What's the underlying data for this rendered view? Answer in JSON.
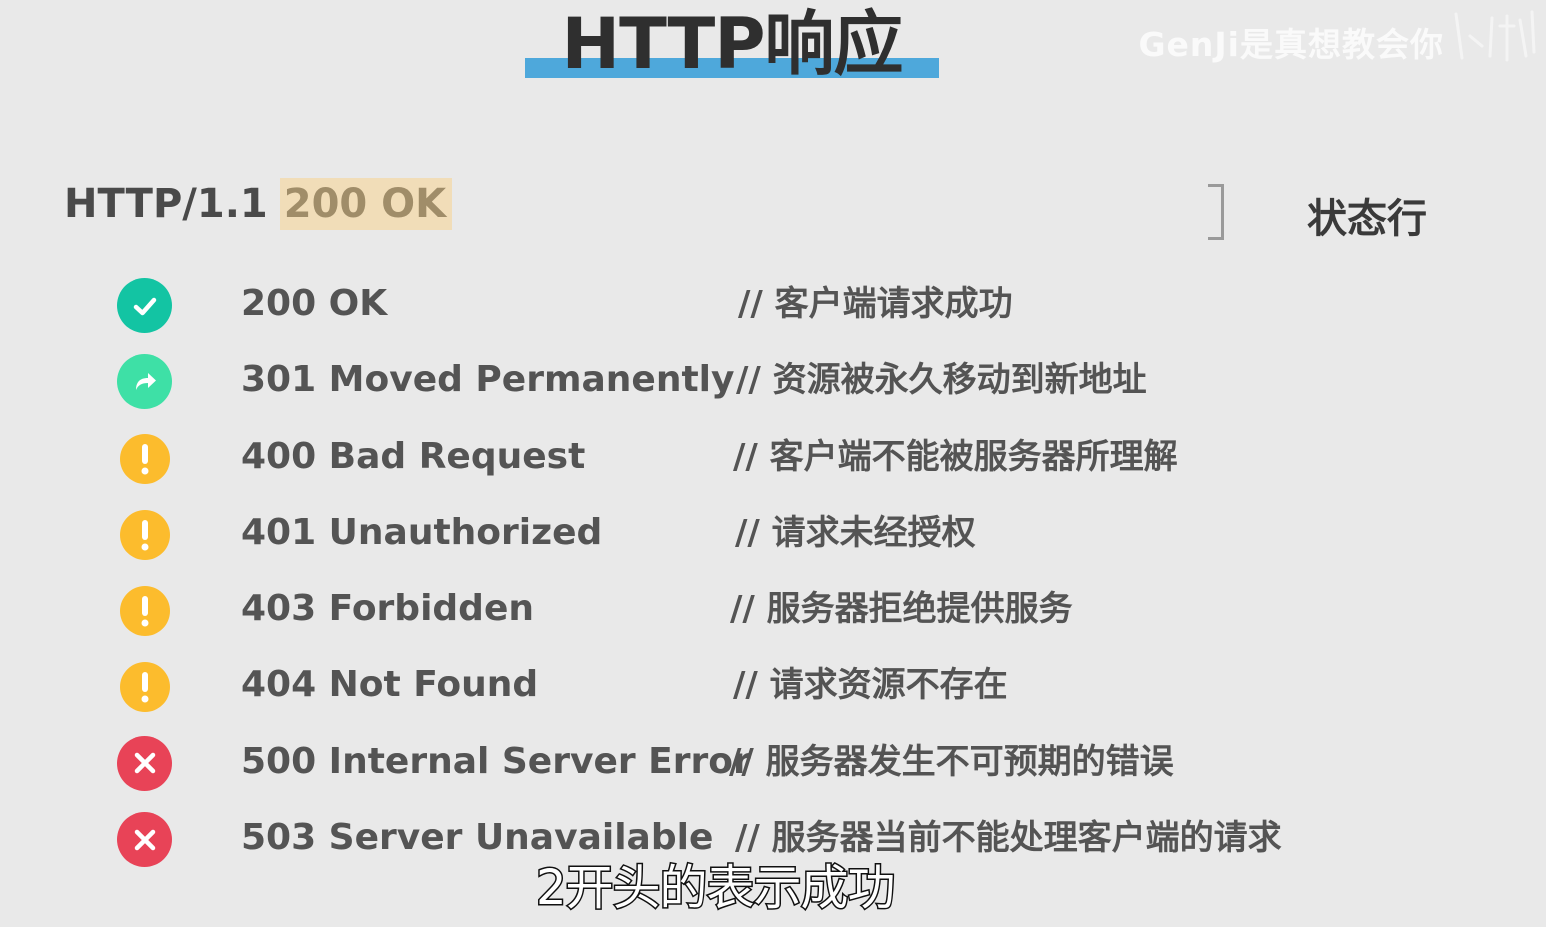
{
  "title": "HTTP响应",
  "watermark": "GenJi是真想教会你",
  "status_line": {
    "version": "HTTP/1.1",
    "status": "200 OK",
    "label": "状态行"
  },
  "codes": [
    {
      "code": "200 OK",
      "desc": "// 客户端请求成功",
      "icon": "check-icon",
      "kind": "success"
    },
    {
      "code": "301 Moved Permanently",
      "desc": "// 资源被永久移动到新地址",
      "icon": "redirect-arrow-icon",
      "kind": "redirect"
    },
    {
      "code": "400 Bad Request",
      "desc": "// 客户端不能被服务器所理解",
      "icon": "exclamation-icon",
      "kind": "warn"
    },
    {
      "code": "401 Unauthorized",
      "desc": "// 请求未经授权",
      "icon": "exclamation-icon",
      "kind": "warn"
    },
    {
      "code": "403 Forbidden",
      "desc": "// 服务器拒绝提供服务",
      "icon": "exclamation-icon",
      "kind": "warn"
    },
    {
      "code": "404 Not Found",
      "desc": "// 请求资源不存在",
      "icon": "exclamation-icon",
      "kind": "warn"
    },
    {
      "code": "500 Internal Server Error",
      "desc": "// 服务器发生不可预期的错误",
      "icon": "close-x-icon",
      "kind": "error"
    },
    {
      "code": "503 Server Unavailable",
      "desc": "// 服务器当前不能处理客户端的请求",
      "icon": "close-x-icon",
      "kind": "error"
    }
  ],
  "subtitle": "2开头的表示成功",
  "colors": {
    "title_bar": "#4ea8db",
    "highlight": "#f1ddb8",
    "success": "#13c4a3",
    "redirect": "#3ee0a6",
    "warn": "#fcbc2d",
    "error": "#e84357",
    "background": "#e9e9e9"
  }
}
